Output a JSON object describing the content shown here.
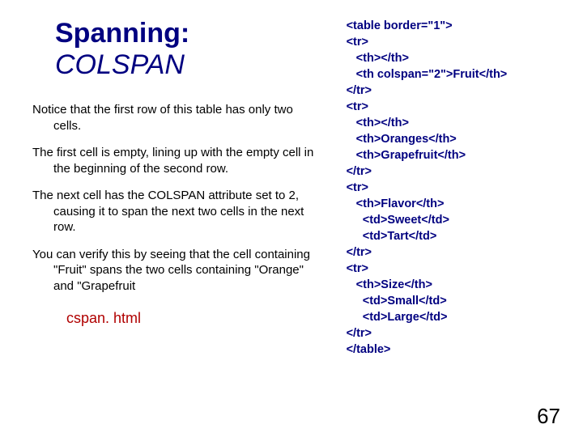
{
  "title": {
    "line1": "Spanning:",
    "line2": "COLSPAN"
  },
  "paragraphs": {
    "p1": "Notice that the first row of this table has only two cells.",
    "p2": "The first cell is empty, lining up with the empty cell in the beginning of the second row.",
    "p3": "The next cell has the COLSPAN attribute set to 2, causing it to span the next two cells in the next row.",
    "p4": "You can verify this by seeing that the cell containing \"Fruit\" spans the two cells containing \"Orange\" and \"Grapefruit"
  },
  "link_text": "cspan. html",
  "code": "<table border=\"1\">\n<tr>\n   <th></th>\n   <th colspan=\"2\">Fruit</th>\n</tr>\n<tr>\n   <th></th>\n   <th>Oranges</th>\n   <th>Grapefruit</th>\n</tr>\n<tr>\n   <th>Flavor</th>\n     <td>Sweet</td>\n     <td>Tart</td>\n</tr>\n<tr>\n   <th>Size</th>\n     <td>Small</td>\n     <td>Large</td>\n</tr>\n</table>",
  "page_number": "67"
}
